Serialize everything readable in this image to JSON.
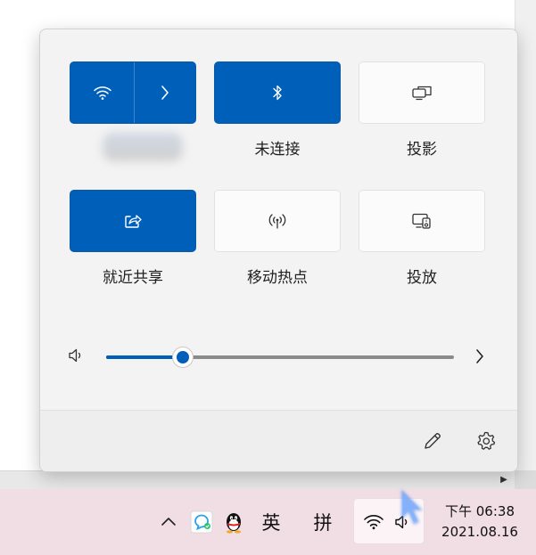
{
  "quick_settings": {
    "tiles": [
      {
        "id": "wifi",
        "label": "",
        "state": "on",
        "icon": "wifi-icon",
        "expand_icon": "chevron-right-icon"
      },
      {
        "id": "bluetooth",
        "label": "未连接",
        "state": "on",
        "icon": "bluetooth-icon"
      },
      {
        "id": "project",
        "label": "投影",
        "state": "off",
        "icon": "project-icon"
      },
      {
        "id": "nearby_sharing",
        "label": "就近共享",
        "state": "on",
        "icon": "share-icon"
      },
      {
        "id": "mobile_hotspot",
        "label": "移动热点",
        "state": "off",
        "icon": "hotspot-icon"
      },
      {
        "id": "cast",
        "label": "投放",
        "state": "off",
        "icon": "cast-icon"
      }
    ],
    "volume": {
      "icon": "speaker-icon",
      "level_percent": 22,
      "more_icon": "chevron-right-icon"
    },
    "footer": {
      "edit_icon": "pencil-icon",
      "settings_icon": "gear-icon"
    }
  },
  "taskbar": {
    "overflow_icon": "chevron-up-icon",
    "ime_lang": "英",
    "ime_mode": "拼",
    "clock": {
      "time": "下午 06:38",
      "date": "2021.08.16"
    }
  },
  "colors": {
    "accent": "#005fb8",
    "taskbar": "#f1dde4",
    "panel": "#f3f3f3"
  }
}
